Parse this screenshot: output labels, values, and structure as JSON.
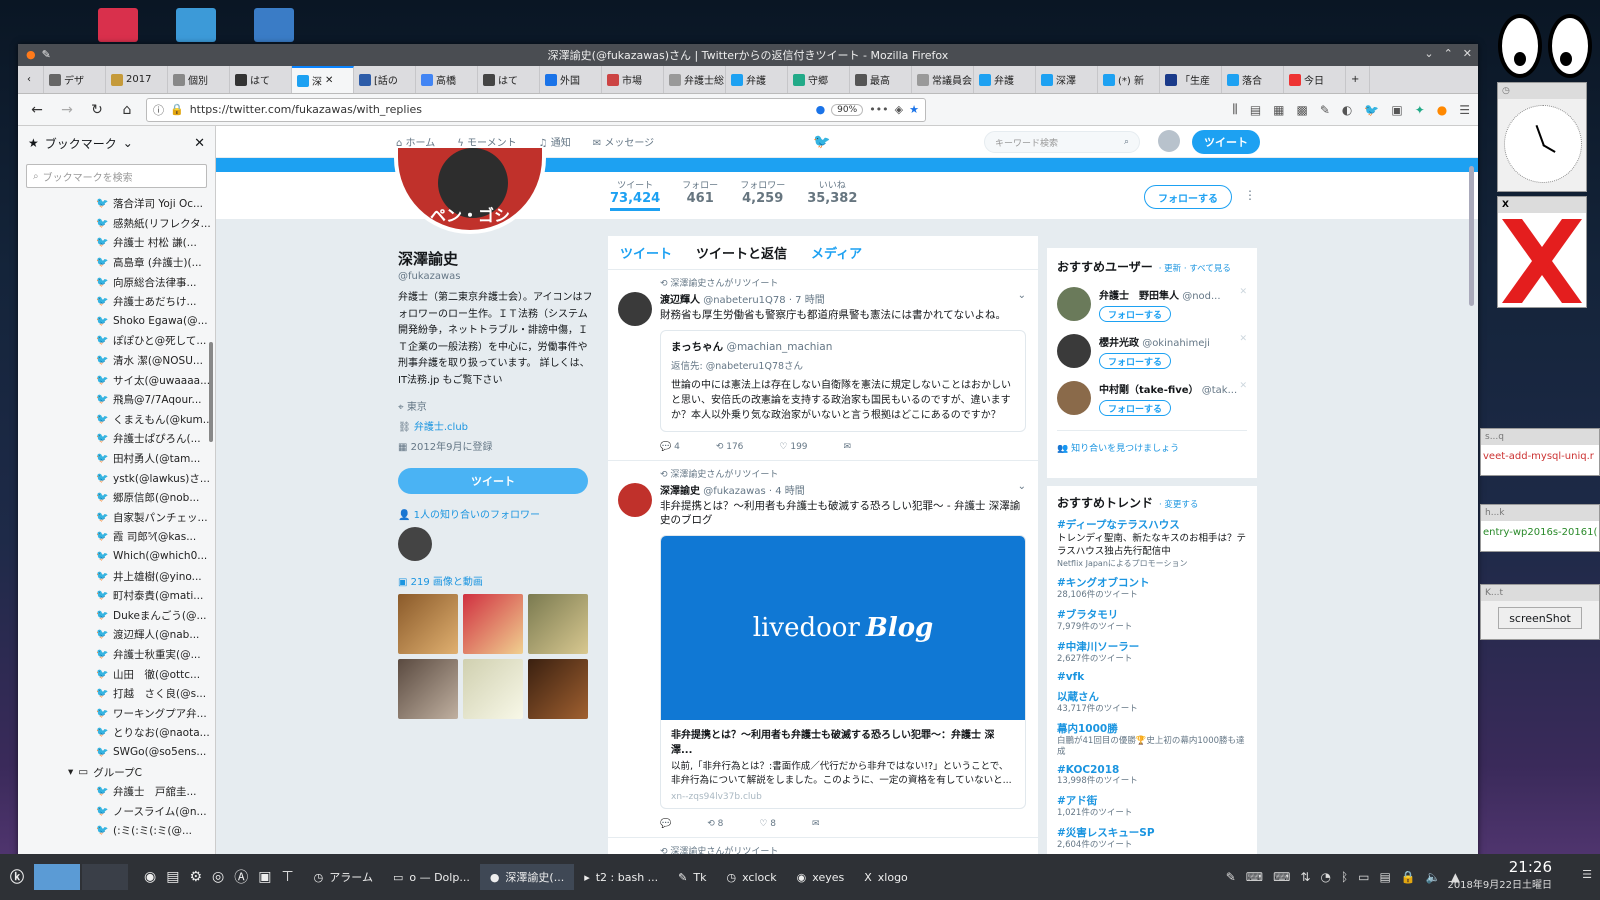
{
  "window_title": "深澤諭史(@fukazawas)さん | Twitterからの返信付きツイート - Mozilla Firefox",
  "tabs": [
    {
      "label": "デザ",
      "icon": "info-icon",
      "color": "#666"
    },
    {
      "label": "2017",
      "icon": "page-icon",
      "color": "#c59a3a"
    },
    {
      "label": "個別",
      "icon": "page-icon",
      "color": "#888"
    },
    {
      "label": "はて",
      "icon": "page-icon",
      "color": "#333"
    },
    {
      "label": "深",
      "icon": "twitter-icon",
      "color": "#1da1f2"
    },
    {
      "label": "[話の",
      "icon": "page-icon",
      "color": "#2d5ca8"
    },
    {
      "label": "高橋",
      "icon": "google-icon",
      "color": "#4285f4"
    },
    {
      "label": "はて",
      "icon": "info-icon",
      "color": "#444"
    },
    {
      "label": "外国",
      "icon": "page-icon",
      "color": "#1a73e8"
    },
    {
      "label": "市場",
      "icon": "page-icon",
      "color": "#c44"
    },
    {
      "label": "弁護士総",
      "icon": "page-icon",
      "color": "#999"
    },
    {
      "label": "弁護",
      "icon": "twitter-icon",
      "color": "#1da1f2"
    },
    {
      "label": "守郷",
      "icon": "page-icon",
      "color": "#2a8"
    },
    {
      "label": "最高",
      "icon": "page-icon",
      "color": "#555"
    },
    {
      "label": "常議員会",
      "icon": "page-icon",
      "color": "#999"
    },
    {
      "label": "弁護",
      "icon": "twitter-icon",
      "color": "#1da1f2"
    },
    {
      "label": "深澤",
      "icon": "twitter-icon",
      "color": "#1da1f2"
    },
    {
      "label": "(*) 新",
      "icon": "twitter-icon",
      "color": "#1da1f2"
    },
    {
      "label": "「生産",
      "icon": "page-icon",
      "color": "#1a3a8a"
    },
    {
      "label": "落合",
      "icon": "twitter-icon",
      "color": "#1da1f2"
    },
    {
      "label": "今日",
      "icon": "yahoo-icon",
      "color": "#e33"
    }
  ],
  "url": "https://twitter.com/fukazawas/with_replies",
  "zoom": "90%",
  "sidebar": {
    "title": "ブックマーク",
    "search_placeholder": "ブックマークを検索",
    "items": [
      "落合洋司 Yoji Oc...",
      "感熱紙(リフレクタ...",
      "弁護士 村松 謙(...",
      "高島章 (弁護士)(...",
      "向原総合法律事...",
      "弁護士あだちけ...",
      "Shoko Egawa(@...",
      "ぽぽひと@死して...",
      "清水 潔(@NOSU...",
      "サイ太(@uwaaaa...",
      "飛鳥@7/7Aqour...",
      "くまえもん(@kum...",
      "弁護士ぱぴろん(...",
      "田村勇人(@tam...",
      "ystk(@lawkus)さ...",
      "郷原信郎(@nob...",
      "自家製パンチェッ...",
      "霞 司郎⁵⁄(@kas...",
      "Which(@which0...",
      "井上雄樹(@yino...",
      "町村泰貴(@mati...",
      "Dukeまんごう(@...",
      "渡辺輝人(@nab...",
      "弁護士秋重実(@...",
      "山田　徹(@ottc...",
      "打越　さく良(@s...",
      "ワーキングプア弁...",
      "とりなお(@naota...",
      "SWGo(@so5ens..."
    ],
    "folder": "グループC",
    "items2": [
      "弁護士　戸舘圭...",
      "ノースライム(@n...",
      "(:ミ(:ミ(:ミ(@..."
    ]
  },
  "twitter": {
    "nav": [
      "ホーム",
      "モーメント",
      "通知",
      "メッセージ"
    ],
    "search_placeholder": "キーワード検索",
    "tweet_button": "ツイート",
    "stats": [
      {
        "label": "ツイート",
        "value": "73,424"
      },
      {
        "label": "フォロー",
        "value": "461"
      },
      {
        "label": "フォロワー",
        "value": "4,259"
      },
      {
        "label": "いいね",
        "value": "35,382"
      }
    ],
    "follow_button": "フォローする",
    "avatar_text": "ペン・ゴシ",
    "profile": {
      "name": "深澤諭史",
      "handle": "@fukazawas",
      "bio": "弁護士（第二東京弁護士会）。アイコンはフォロワーのロー生作。ＩＴ法務（システム開発紛争，ネットトラブル・誹謗中傷，ＩＴ企業の一般法務）を中心に，労働事件や刑事弁護を取り扱っています。 詳しくは、 IT法務.jp もご覧下さい",
      "location": "東京",
      "website": "弁護士.club",
      "joined": "2012年9月に登録",
      "tweet_button": "ツイート",
      "followers_you_know": "1人の知り合いのフォロワー",
      "media_link": "219 画像と動画"
    },
    "timeline_tabs": [
      "ツイート",
      "ツイートと返信",
      "メディア"
    ],
    "tweet1": {
      "retweeted_by": "深澤諭史さんがリツイート",
      "name": "渡辺輝人",
      "handle": "@nabeteru1Q78",
      "time": "· 7 時間",
      "text": "財務省も厚生労働省も警察庁も都道府県警も憲法には書かれてないよね。",
      "quote_name": "まっちゃん",
      "quote_handle": "@machian_machian",
      "quote_reply": "返信先: @nabeteru1Q78さん",
      "quote_text": "世論の中には憲法上は存在しない自衛隊を憲法に規定しないことはおかしいと思い、安倍氏の改憲論を支持する政治家も国民もいるのですが、違いますか？本人以外乗り気な政治家がいないと言う根拠はどこにあるのですか？",
      "replies": "4",
      "retweets": "176",
      "likes": "199"
    },
    "tweet2": {
      "retweeted_by": "深澤諭史さんがリツイート",
      "name": "深澤諭史",
      "handle": "@fukazawas",
      "time": "· 4 時間",
      "text": "非弁提携とは？〜利用者も弁護士も破滅する恐ろしい犯罪〜 - 弁護士 深澤諭史のブログ",
      "card_brand1": "livedoor",
      "card_brand2": "Blog",
      "card_title": "非弁提携とは？〜利用者も弁護士も破滅する恐ろしい犯罪〜：弁護士 深澤...",
      "card_desc": "以前,「非弁行為とは？:書面作成／代行だから非弁ではない!?」ということで、非弁行為について解説をしました。このように、一定の資格を有していないと...",
      "card_domain": "xn--zqs94lv37b.club",
      "replies": "",
      "retweets": "8",
      "likes": "8"
    },
    "tweet3_rt": "深澤諭史さんがリツイート",
    "who_to_follow": {
      "title": "おすすめユーザー",
      "links": "· 更新 · すべて見る",
      "users": [
        {
          "name": "弁護士　野田隼人",
          "handle": "@nod...",
          "button": "フォローする"
        },
        {
          "name": "櫻井光政",
          "handle": "@okinahimeji",
          "button": "フォローする"
        },
        {
          "name": "中村剛（take-five）",
          "handle": "@tak...",
          "button": "フォローする"
        }
      ],
      "find_friends": "知り合いを見つけましょう"
    },
    "trends": {
      "title": "おすすめトレンド",
      "change": "· 変更する",
      "items": [
        {
          "name": "#ディープなテラスハウス",
          "desc": "トレンディ聖南、新たなキスのお相手は？テラスハウス独占先行配信中",
          "promo": "Netflix Japanによるプロモーション"
        },
        {
          "name": "#キングオブコント",
          "count": "28,106件のツイート"
        },
        {
          "name": "#ブラタモリ",
          "count": "7,979件のツイート"
        },
        {
          "name": "#中津川ソーラー",
          "count": "2,627件のツイート"
        },
        {
          "name": "#vfk"
        },
        {
          "name": "以蔵さん",
          "count": "43,717件のツイート"
        },
        {
          "name": "幕内1000勝",
          "count": "白鵬が41回目の優勝🏆史上初の幕内1000勝も達成"
        },
        {
          "name": "#KOC2018",
          "count": "13,998件のツイート"
        },
        {
          "name": "#アド街",
          "count": "1,021件のツイート"
        },
        {
          "name": "#災害レスキューSP",
          "count": "2,604件のツイート"
        }
      ]
    }
  },
  "widgets": {
    "w1": "s...q",
    "w1_text": "veet-add-mysql-uniq.r",
    "w2": "h...k",
    "w2_text": "entry-wp2016s-20161(",
    "w3": "K...t",
    "w3_button": "screenShot"
  },
  "taskbar": {
    "tasks": [
      "アラーム",
      "o — Dolp...",
      "深澤諭史(...",
      "t2 : bash ...",
      "Tk",
      "xclock",
      "xeyes",
      "xlogo"
    ],
    "time": "21:26",
    "date": "2018年9月22日土曜日"
  }
}
